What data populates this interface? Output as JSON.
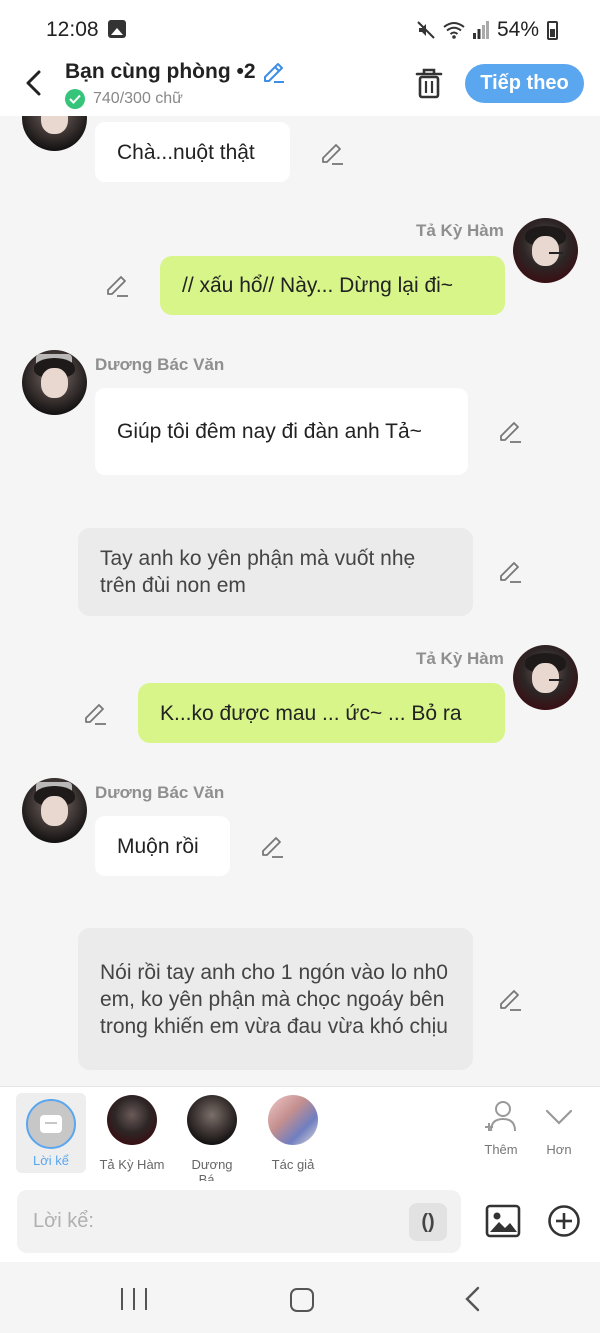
{
  "status_bar": {
    "time": "12:08",
    "battery": "54%"
  },
  "header": {
    "title": "Bạn cùng phòng •2",
    "word_count": "740/300 chữ",
    "next_label": "Tiếp theo"
  },
  "characters": {
    "a": {
      "name": "Tả Kỳ Hàm"
    },
    "b": {
      "name": "Dương Bác Văn"
    }
  },
  "messages": [
    {
      "type": "white",
      "text": "Chà...nuột thật"
    },
    {
      "type": "green",
      "sender": "Tả Kỳ Hàm",
      "text": "// xấu hổ// Này... Dừng lại đi~"
    },
    {
      "type": "white",
      "sender": "Dương Bác Văn",
      "text": "Giúp tôi đêm nay đi đàn anh Tả~"
    },
    {
      "type": "gray",
      "text": "Tay anh ko yên phận mà vuốt nhẹ trên đùi non em"
    },
    {
      "type": "green",
      "sender": "Tả Kỳ Hàm",
      "text": "K...ko được mau ... ức~ ... Bỏ ra"
    },
    {
      "type": "white",
      "sender": "Dương Bác Văn",
      "text": "Muộn rồi"
    },
    {
      "type": "gray",
      "text": "Nói rồi tay anh cho 1 ngón vào lo nh0 em, ko yên phận mà chọc ngoáy bên trong khiến em vừa đau vừa khó chịu"
    }
  ],
  "char_bar": {
    "narrator_label": "Lời kể",
    "char1_label": "Tả Kỳ Hàm",
    "char2_label": "Dương Bá...",
    "author_label": "Tác giả",
    "add_label": "Thêm",
    "more_label": "Hơn"
  },
  "input": {
    "placeholder": "Lời kể:",
    "paren_label": "()"
  }
}
